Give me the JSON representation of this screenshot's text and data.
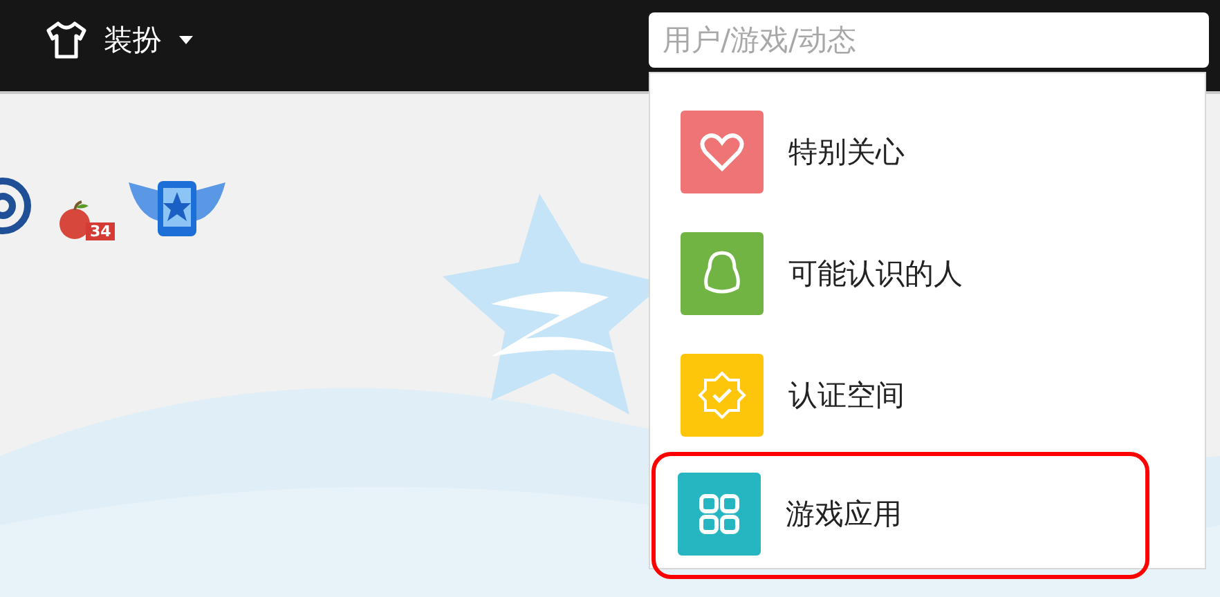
{
  "topbar": {
    "menu_label": "装扮"
  },
  "search": {
    "placeholder": "用户/游戏/动态"
  },
  "profile_badges": {
    "apple_count": "34"
  },
  "dropdown": {
    "items": [
      {
        "label": "特别关心",
        "kind": "heart",
        "color": "#ee7475",
        "selected": false
      },
      {
        "label": "可能认识的人",
        "kind": "penguin",
        "color": "#72b444",
        "selected": false
      },
      {
        "label": "认证空间",
        "kind": "badge",
        "color": "#fec60b",
        "selected": false
      },
      {
        "label": "游戏应用",
        "kind": "apps",
        "color": "#26b6c2",
        "selected": true
      }
    ]
  }
}
